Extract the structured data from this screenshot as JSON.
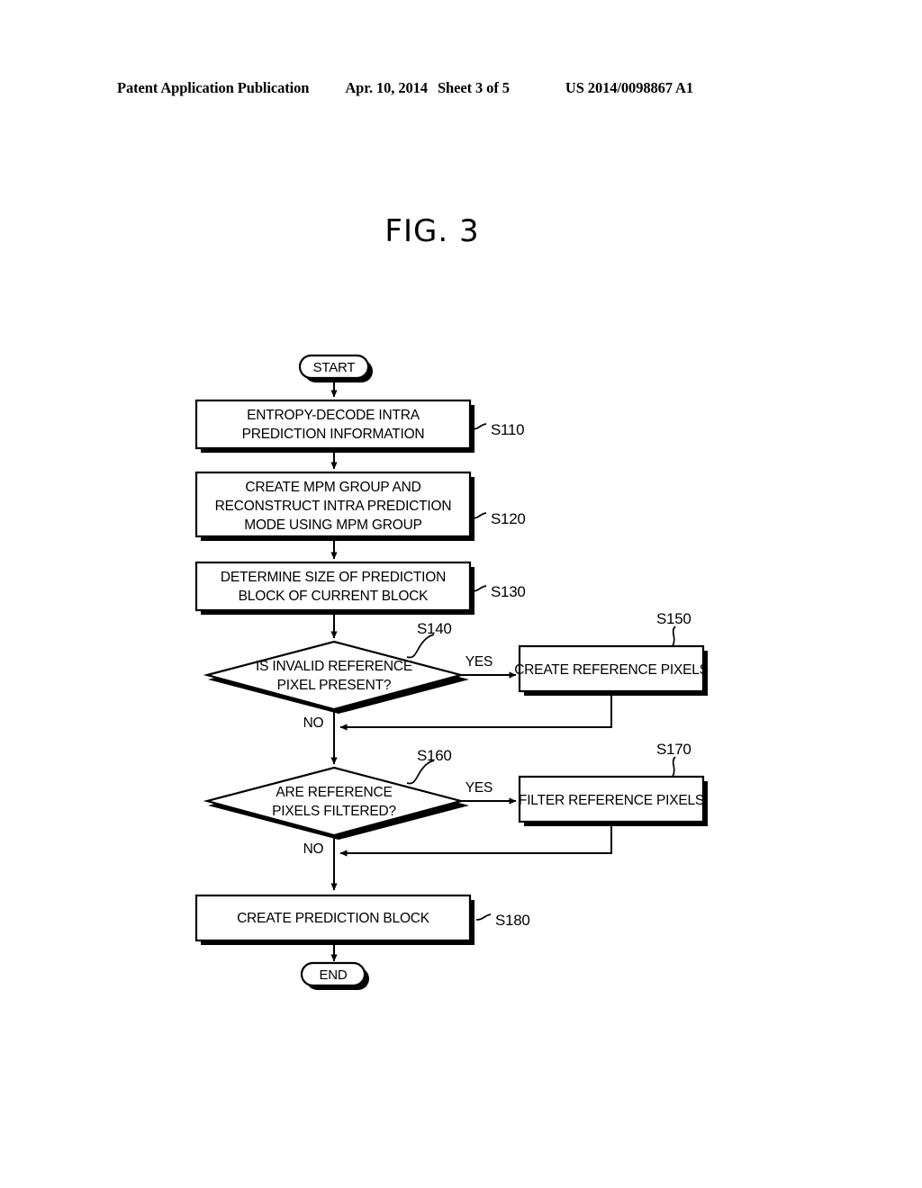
{
  "header": {
    "publication": "Patent Application Publication",
    "date": "Apr. 10, 2014",
    "sheet": "Sheet 3 of 5",
    "number": "US 2014/0098867 A1"
  },
  "figure": {
    "title": "FIG. 3"
  },
  "flowchart": {
    "start_label": "START",
    "end_label": "END",
    "yes_label_1": "YES",
    "no_label_1": "NO",
    "yes_label_2": "YES",
    "no_label_2": "NO",
    "steps": {
      "s110": {
        "id": "S110",
        "line1": "ENTROPY-DECODE INTRA",
        "line2": "PREDICTION INFORMATION"
      },
      "s120": {
        "id": "S120",
        "line1": "CREATE MPM GROUP AND",
        "line2": "RECONSTRUCT INTRA PREDICTION",
        "line3": "MODE USING MPM GROUP"
      },
      "s130": {
        "id": "S130",
        "line1": "DETERMINE SIZE OF PREDICTION",
        "line2": "BLOCK OF CURRENT BLOCK"
      },
      "s140": {
        "id": "S140",
        "line1": "IS INVALID REFERENCE",
        "line2": "PIXEL PRESENT?"
      },
      "s150": {
        "id": "S150",
        "line1": "CREATE REFERENCE PIXELS"
      },
      "s160": {
        "id": "S160",
        "line1": "ARE REFERENCE",
        "line2": "PIXELS FILTERED?"
      },
      "s170": {
        "id": "S170",
        "line1": "FILTER REFERENCE PIXELS"
      },
      "s180": {
        "id": "S180",
        "line1": "CREATE PREDICTION BLOCK"
      }
    }
  },
  "colors": {
    "ink": "#000000",
    "paper": "#ffffff"
  }
}
